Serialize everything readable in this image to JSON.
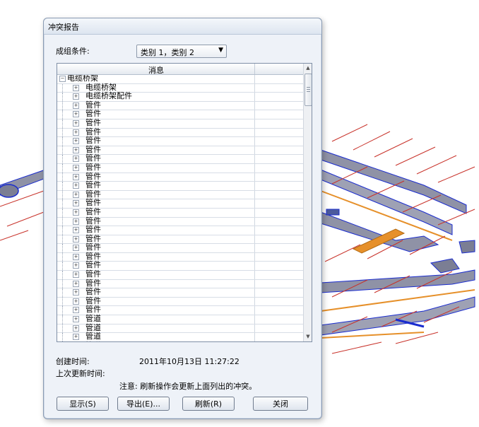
{
  "dialog": {
    "title": "冲突报告",
    "group_label": "成组条件:",
    "group_value": "类别 1，类别 2",
    "list_header": "消息",
    "rows": [
      {
        "label": "电缆桥架",
        "level": 0,
        "expander": "⊟"
      },
      {
        "label": "电缆桥架",
        "level": 1,
        "expander": "⊞"
      },
      {
        "label": "电缆桥架配件",
        "level": 1,
        "expander": "⊞"
      },
      {
        "label": "管件",
        "level": 1,
        "expander": "⊞"
      },
      {
        "label": "管件",
        "level": 1,
        "expander": "⊞"
      },
      {
        "label": "管件",
        "level": 1,
        "expander": "⊞"
      },
      {
        "label": "管件",
        "level": 1,
        "expander": "⊞"
      },
      {
        "label": "管件",
        "level": 1,
        "expander": "⊞"
      },
      {
        "label": "管件",
        "level": 1,
        "expander": "⊞"
      },
      {
        "label": "管件",
        "level": 1,
        "expander": "⊞"
      },
      {
        "label": "管件",
        "level": 1,
        "expander": "⊞"
      },
      {
        "label": "管件",
        "level": 1,
        "expander": "⊞"
      },
      {
        "label": "管件",
        "level": 1,
        "expander": "⊞"
      },
      {
        "label": "管件",
        "level": 1,
        "expander": "⊞"
      },
      {
        "label": "管件",
        "level": 1,
        "expander": "⊞"
      },
      {
        "label": "管件",
        "level": 1,
        "expander": "⊞"
      },
      {
        "label": "管件",
        "level": 1,
        "expander": "⊞"
      },
      {
        "label": "管件",
        "level": 1,
        "expander": "⊞"
      },
      {
        "label": "管件",
        "level": 1,
        "expander": "⊞"
      },
      {
        "label": "管件",
        "level": 1,
        "expander": "⊞"
      },
      {
        "label": "管件",
        "level": 1,
        "expander": "⊞"
      },
      {
        "label": "管件",
        "level": 1,
        "expander": "⊞"
      },
      {
        "label": "管件",
        "level": 1,
        "expander": "⊞"
      },
      {
        "label": "管件",
        "level": 1,
        "expander": "⊞"
      },
      {
        "label": "管件",
        "level": 1,
        "expander": "⊞"
      },
      {
        "label": "管件",
        "level": 1,
        "expander": "⊞"
      },
      {
        "label": "管件",
        "level": 1,
        "expander": "⊞"
      },
      {
        "label": "管道",
        "level": 1,
        "expander": "⊞"
      },
      {
        "label": "管道",
        "level": 1,
        "expander": "⊞"
      },
      {
        "label": "管道",
        "level": 1,
        "expander": "⊞"
      },
      {
        "label": "管道",
        "level": 1,
        "expander": "⊞"
      },
      {
        "label": "管道",
        "level": 1,
        "expander": "⊞"
      },
      {
        "label": "管道",
        "level": 1,
        "expander": "⊞"
      }
    ],
    "created_label": "创建时间:",
    "created_value": "2011年10月13日 11:27:22",
    "updated_label": "上次更新时间:",
    "note": "注意: 刷新操作会更新上面列出的冲突。",
    "buttons": {
      "show": "显示(S)",
      "export": "导出(E)...",
      "refresh": "刷新(R)",
      "close": "关闭"
    }
  },
  "colors": {
    "duct_gray": "#8f92a6",
    "pipe_red": "#c8322a",
    "pipe_orange": "#e6902a",
    "edge_blue": "#1a2ccf"
  }
}
